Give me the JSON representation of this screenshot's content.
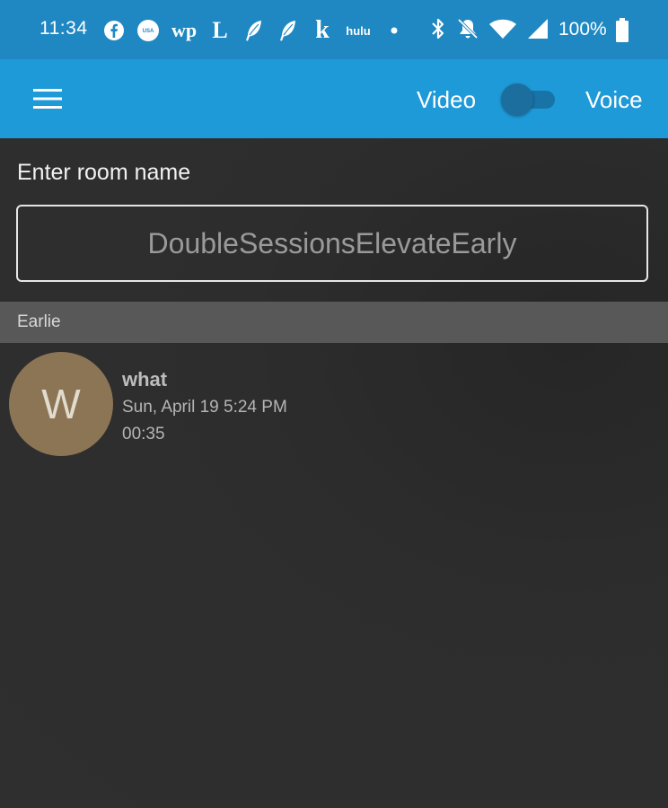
{
  "status_bar": {
    "time": "11:34",
    "notification_icons": [
      "facebook-icon",
      "usa-today-icon",
      "washington-post-icon",
      "la-times-icon",
      "feather-icon",
      "feather-icon",
      "k-icon",
      "hulu-icon",
      "dot-icon"
    ],
    "system_icons": [
      "bluetooth-icon",
      "notifications-off-icon",
      "wifi-icon",
      "cell-signal-icon",
      "battery-icon"
    ],
    "wp_text": "wp",
    "lat_text": "L",
    "k_text": "k",
    "hulu_text": "hulu",
    "usa_text": "USA",
    "battery": "100%"
  },
  "app_bar": {
    "video_label": "Video",
    "voice_label": "Voice",
    "toggle_state": "off",
    "color": "#1e9ad8"
  },
  "room": {
    "label": "Enter room name",
    "placeholder": "DoubleSessionsElevateEarly",
    "value": ""
  },
  "history": {
    "section_title": "Earlie",
    "items": [
      {
        "avatar_letter": "W",
        "avatar_color": "#8c7555",
        "title": "what",
        "date": "Sun, April 19 5:24 PM",
        "duration": "00:35"
      }
    ]
  }
}
